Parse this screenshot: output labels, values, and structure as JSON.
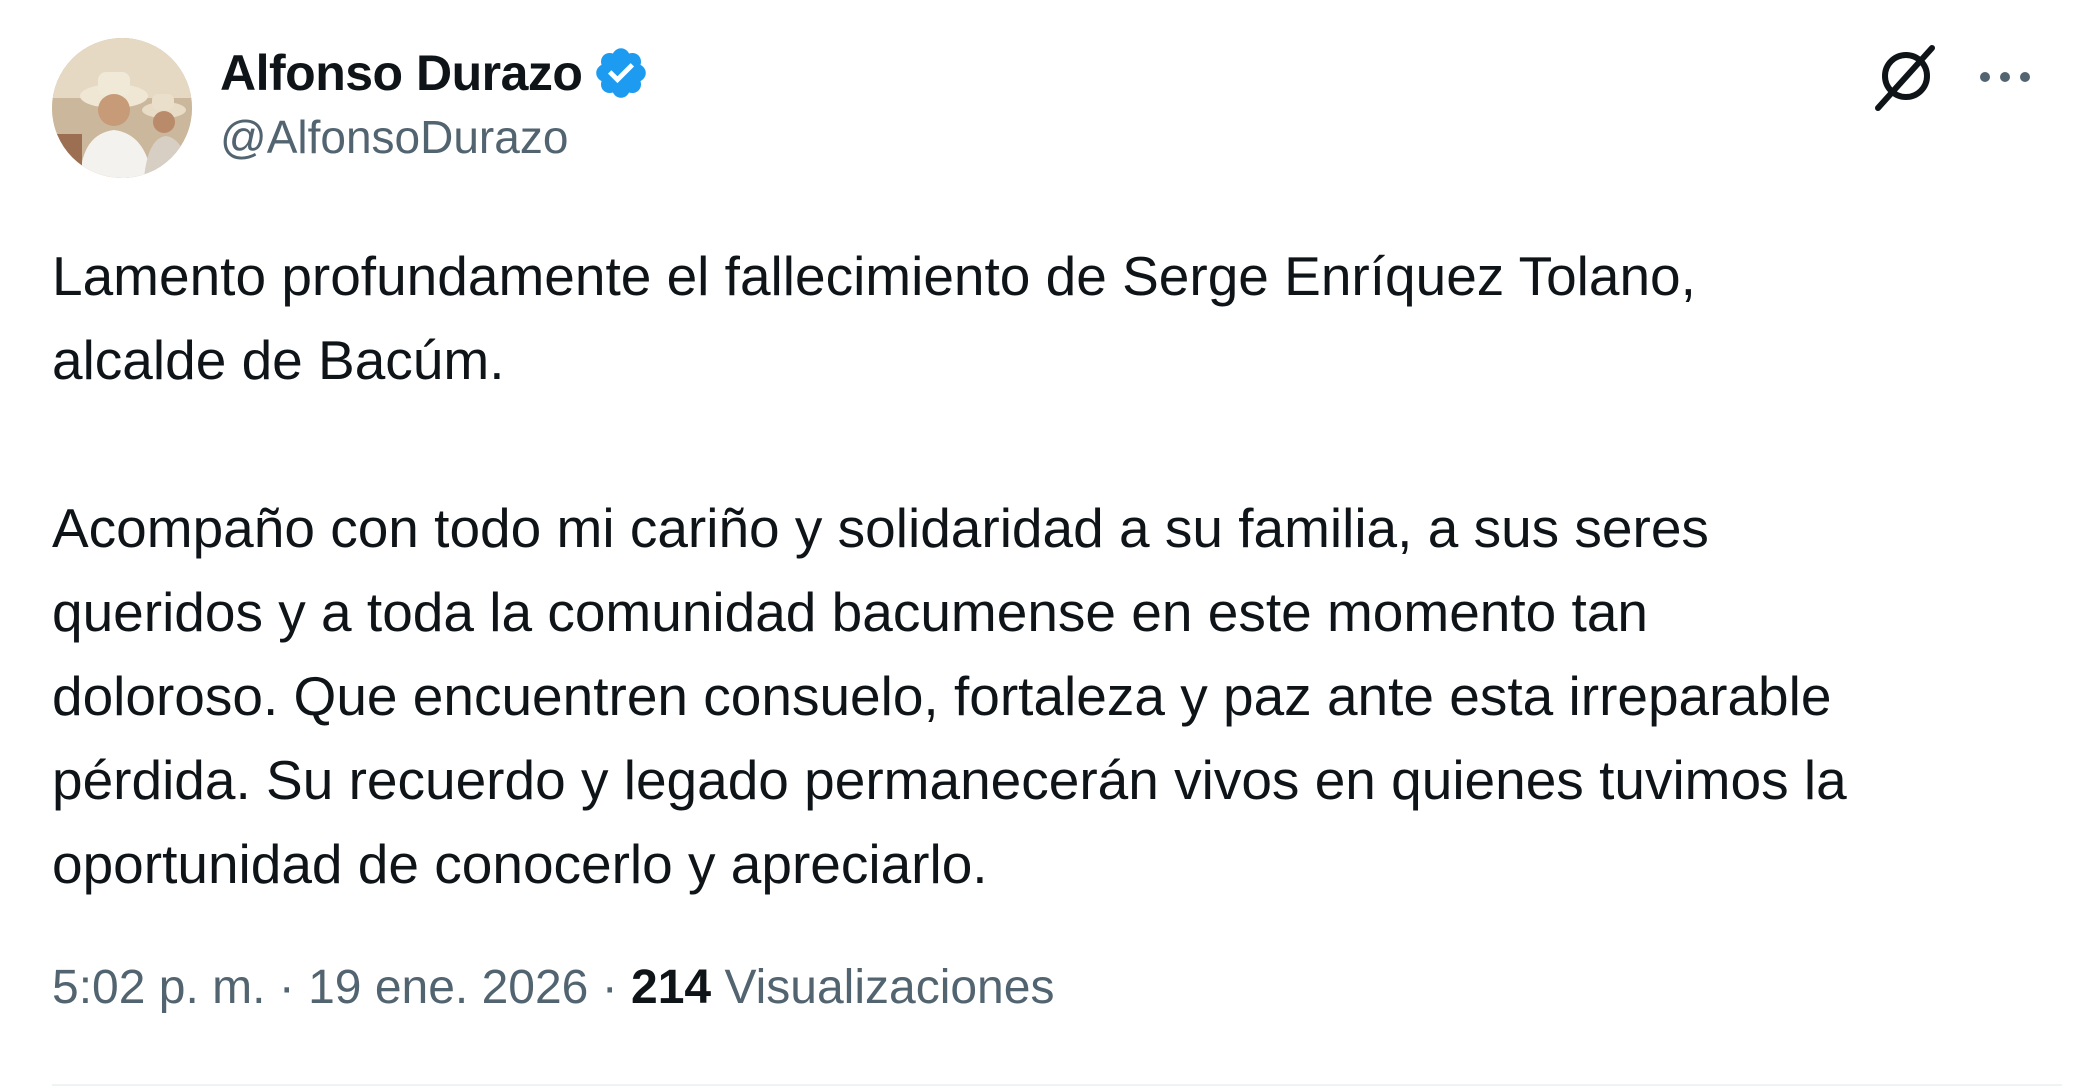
{
  "author": {
    "display_name": "Alfonso Durazo",
    "handle": "@AlfonsoDurazo",
    "verified": true,
    "verified_color": "#1d9bf0",
    "avatar_icon": "profile-photo"
  },
  "actions": {
    "grok_icon": "grok-icon",
    "more_icon": "more-dots-icon"
  },
  "tweet": {
    "text": "Lamento profundamente el fallecimiento de Serge Enríquez Tolano,\nalcalde de Bacúm.\n\nAcompaño con todo mi cariño y solidaridad a su familia, a sus seres\nqueridos y a toda la comunidad bacumense en este momento tan\ndoloroso. Que encuentren consuelo, fortaleza y paz ante esta irreparable\npérdida. Su recuerdo y legado permanecerán vivos en quienes tuvimos la\noportunidad de conocerlo y apreciarlo."
  },
  "meta": {
    "time": "5:02 p. m.",
    "separator": " · ",
    "date": "19 ene. 2026",
    "views_count": "214",
    "views_label": " Visualizaciones"
  },
  "colors": {
    "text_primary": "#0f1419",
    "text_secondary": "#536471",
    "divider": "#eff3f4"
  }
}
